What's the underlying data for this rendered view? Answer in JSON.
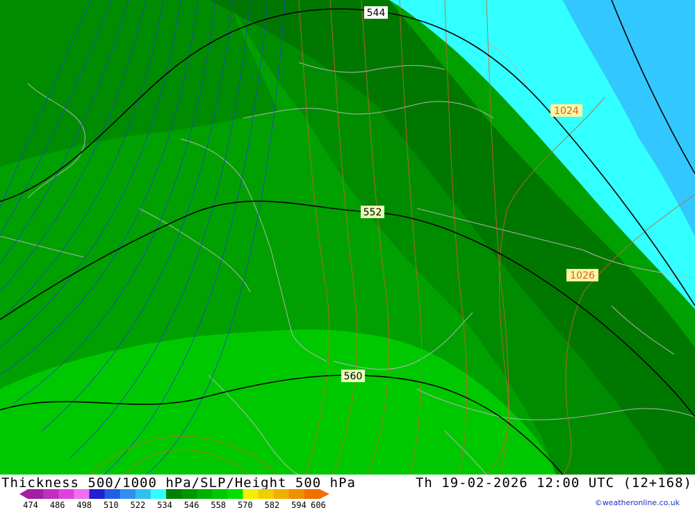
{
  "map": {
    "contour_labels": {
      "thickness_544": "544",
      "thickness_552": "552",
      "thickness_560": "560",
      "slp_1024": "1024",
      "slp_1026": "1026"
    },
    "colors": {
      "dark_green": "#007800",
      "mid_green": "#008c00",
      "green": "#00a000",
      "light_green": "#00b400",
      "bright_green": "#00d200",
      "cyan": "#32ffff",
      "sky_blue": "#32c8ff",
      "thickness_line": "#000000",
      "slp_line": "#c86432",
      "height_line": "#1e46c8",
      "border_line": "#b4b4b4"
    }
  },
  "footer": {
    "title": "Thickness 500/1000 hPa/SLP/Height 500 hPa",
    "valid_time": "Th 19-02-2026 12:00 UTC (12+168)",
    "credit": "©weatheronline.co.uk",
    "scale_ticks": [
      "474",
      "486",
      "498",
      "510",
      "522",
      "534",
      "546",
      "558",
      "570",
      "582",
      "594",
      "606"
    ],
    "scale_colors": [
      "#a020a0",
      "#c030c0",
      "#e040e0",
      "#f070f0",
      "#2020d0",
      "#2060e0",
      "#3090f0",
      "#30c0f0",
      "#30ffff",
      "#008000",
      "#009600",
      "#00b000",
      "#00c800",
      "#00e000",
      "#f0f000",
      "#f0d000",
      "#f0b000",
      "#f09000",
      "#f07000"
    ]
  }
}
